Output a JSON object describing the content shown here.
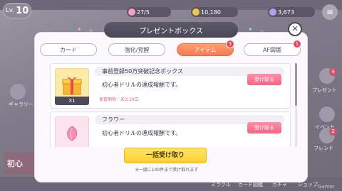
{
  "background": {
    "level_label": "Lv.",
    "level_value": "10",
    "stamina": "27/5",
    "coins": "10,180",
    "jewels": "3,673",
    "menu_icon": "menu-icon",
    "left_banner_text": "初心",
    "side_labels": [
      "プレゼント",
      "イベント",
      "フレンド",
      "ギャラリー"
    ],
    "side_badges": [
      "4",
      "2"
    ],
    "bottom_labels": [
      "ミラクル",
      "カード図鑑",
      "ガチャ",
      "ショップ"
    ],
    "bottom_right_credit": "Gamer"
  },
  "dialog": {
    "title": "プレゼントボックス",
    "close_icon": "close-icon",
    "tabs": [
      {
        "label": "カード",
        "active": false,
        "badge": ""
      },
      {
        "label": "強化/覚醒",
        "active": false,
        "badge": ""
      },
      {
        "label": "アイテム",
        "active": true,
        "badge": "3"
      },
      {
        "label": "AF図鑑",
        "active": false,
        "badge": "1"
      }
    ],
    "items": [
      {
        "name": "事前登録50万突破記念ボックス",
        "description": "初心者ドリルの達成報酬です。",
        "quantity": "X1",
        "expiry": "保管期限：あと29日",
        "receive_label": "受け取る",
        "icon": "gift-box-icon"
      },
      {
        "name": "フラワー",
        "description": "初心者ドリルの達成報酬です。",
        "quantity": "",
        "expiry": "",
        "receive_label": "受け取る",
        "icon": "flower-petal-icon"
      }
    ],
    "bulk_receive_label": "一括受け取り",
    "bulk_note": "※一度に100件まで受け取れます"
  },
  "colors": {
    "accent_orange": "#f77a55",
    "receive_pink": "#f26688",
    "bulk_yellow": "#fccf2e",
    "badge_red": "#e8485e"
  }
}
